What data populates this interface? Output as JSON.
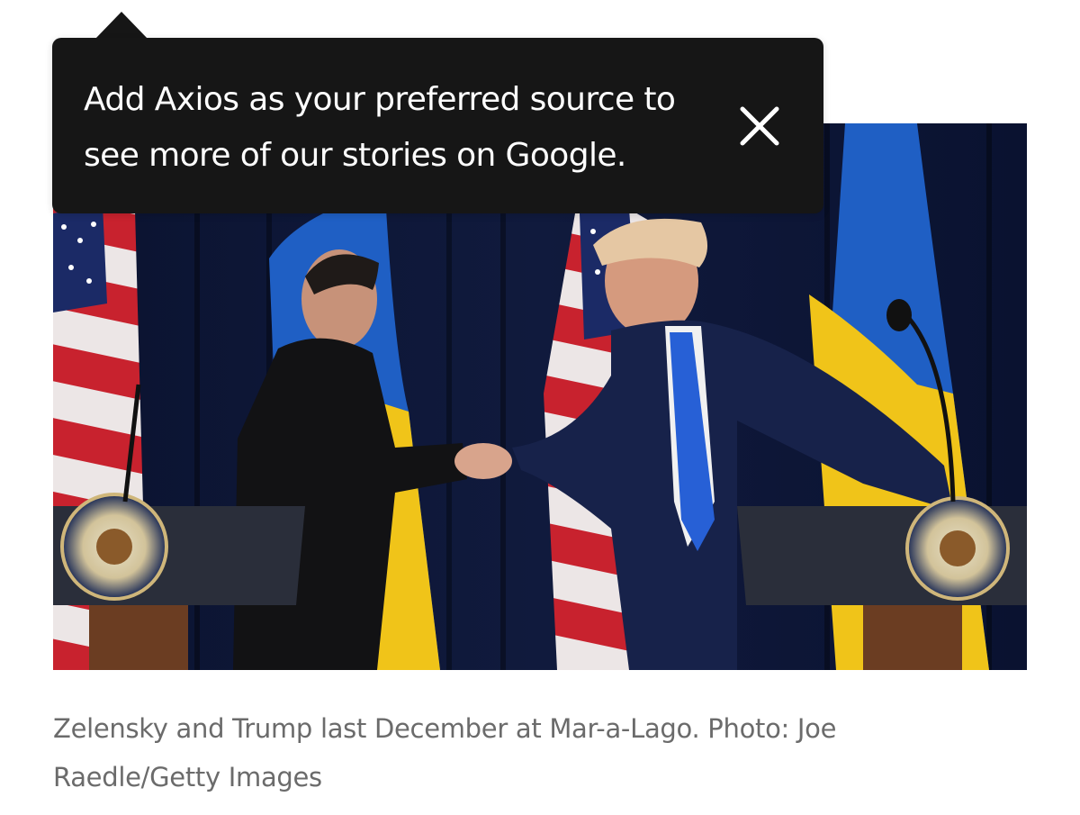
{
  "tooltip": {
    "message": "Add Axios as your preferred source to see more of our stories on Google.",
    "close_icon": "close-icon"
  },
  "photo": {
    "alt": "Zelensky and Trump shaking hands between two podiums with presidential seals, in front of US and Ukrainian flags"
  },
  "caption": "Zelensky and Trump last December at Mar-a-Lago. Photo: Joe Raedle/Getty Images",
  "colors": {
    "tooltip_bg": "#161616",
    "caption_text": "#6b6b6b",
    "backdrop": "#0c1430",
    "ukraine_blue": "#1f5fc4",
    "ukraine_yellow": "#f0c419"
  }
}
